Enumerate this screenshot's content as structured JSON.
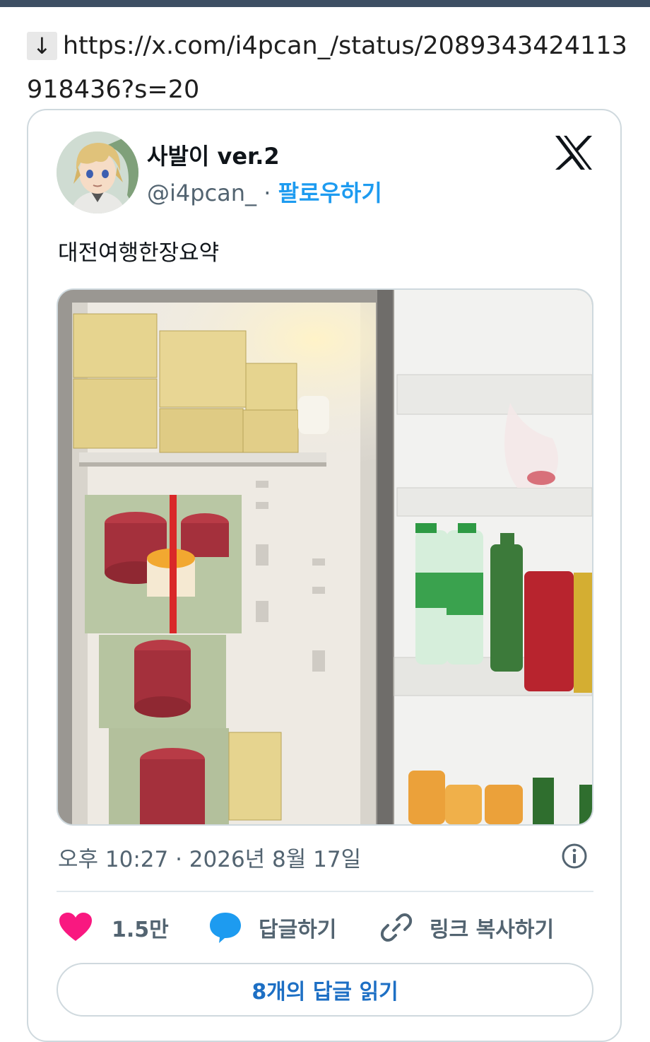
{
  "link": {
    "arrow": "↓",
    "url": "https://x.com/i4pcan_/status/2089343424113918436?s=20"
  },
  "tweet": {
    "author_name": "사발이 ver.2",
    "handle": "@i4pcan_",
    "separator": "·",
    "follow_label": "팔로우하기",
    "text": "대전여행한장요약",
    "timestamp": "오후 10:27 · 2026년 8월 17일",
    "likes": "1.5만",
    "reply_label": "답글하기",
    "copy_link_label": "링크 복사하기",
    "read_replies_label": "8개의 답글 읽기"
  },
  "icons": {
    "logo": "x-logo-icon",
    "info": "info-icon",
    "like": "heart-icon",
    "reply": "speech-bubble-icon",
    "copy": "link-icon"
  },
  "colors": {
    "accent": "#1d9bf0",
    "like": "#f91880",
    "header_bar": "#3d4f63",
    "text_secondary": "#536471",
    "border": "#cfd9de"
  }
}
